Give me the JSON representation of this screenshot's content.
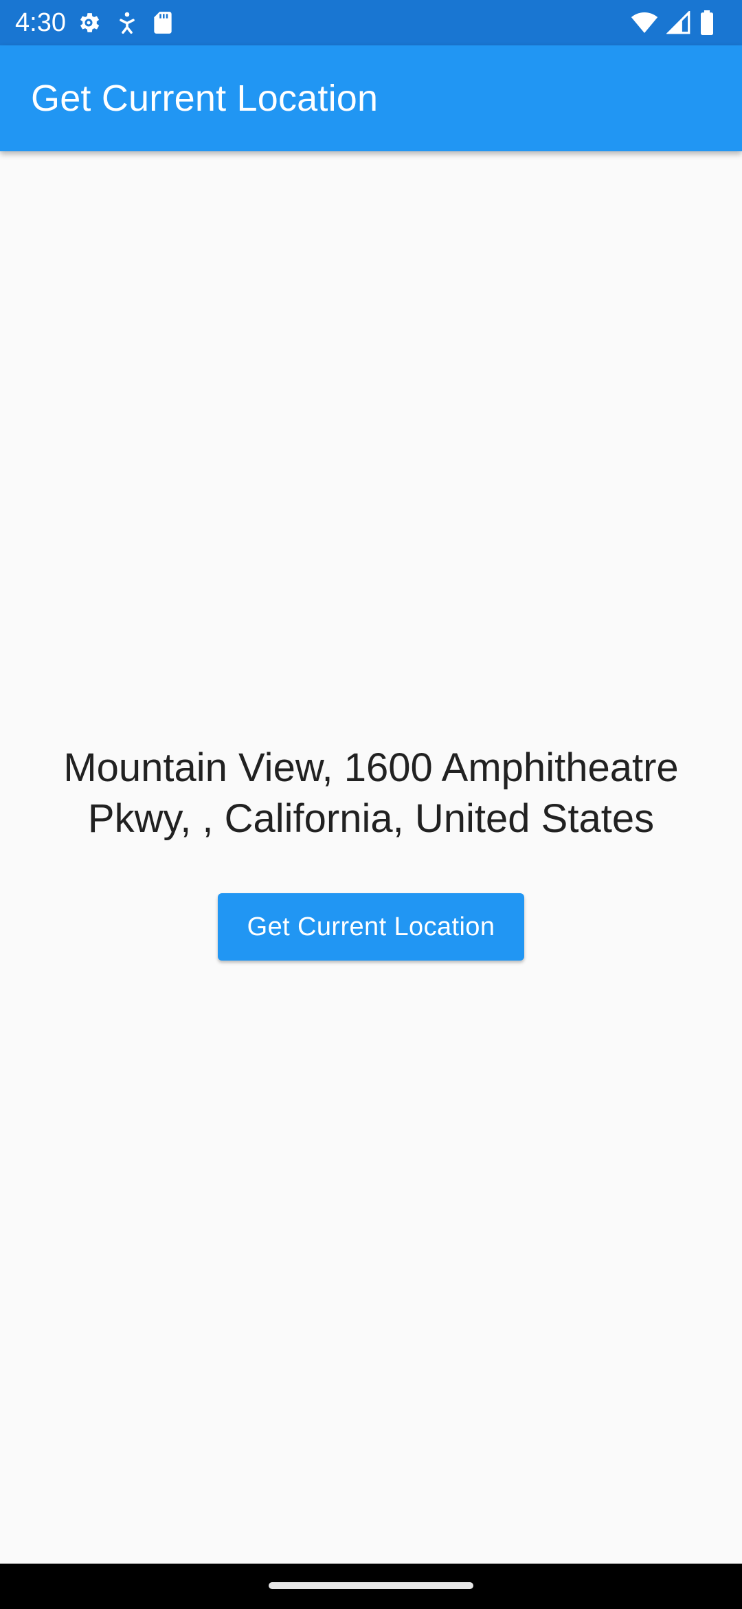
{
  "status_bar": {
    "time": "4:30",
    "left_icons": [
      "settings-icon",
      "accessibility-icon",
      "sd-card-icon"
    ],
    "right_icons": [
      "wifi-icon",
      "cellular-signal-icon",
      "battery-icon"
    ],
    "background_color": "#1976d2"
  },
  "app_bar": {
    "title": "Get Current Location",
    "background_color": "#2196f3"
  },
  "main": {
    "address_text": "Mountain View, 1600 Amphitheatre Pkwy, , California, United States",
    "button_label": "Get Current Location",
    "button_color": "#2196f3"
  },
  "nav_bar": {
    "handle": "home-gesture-handle"
  }
}
